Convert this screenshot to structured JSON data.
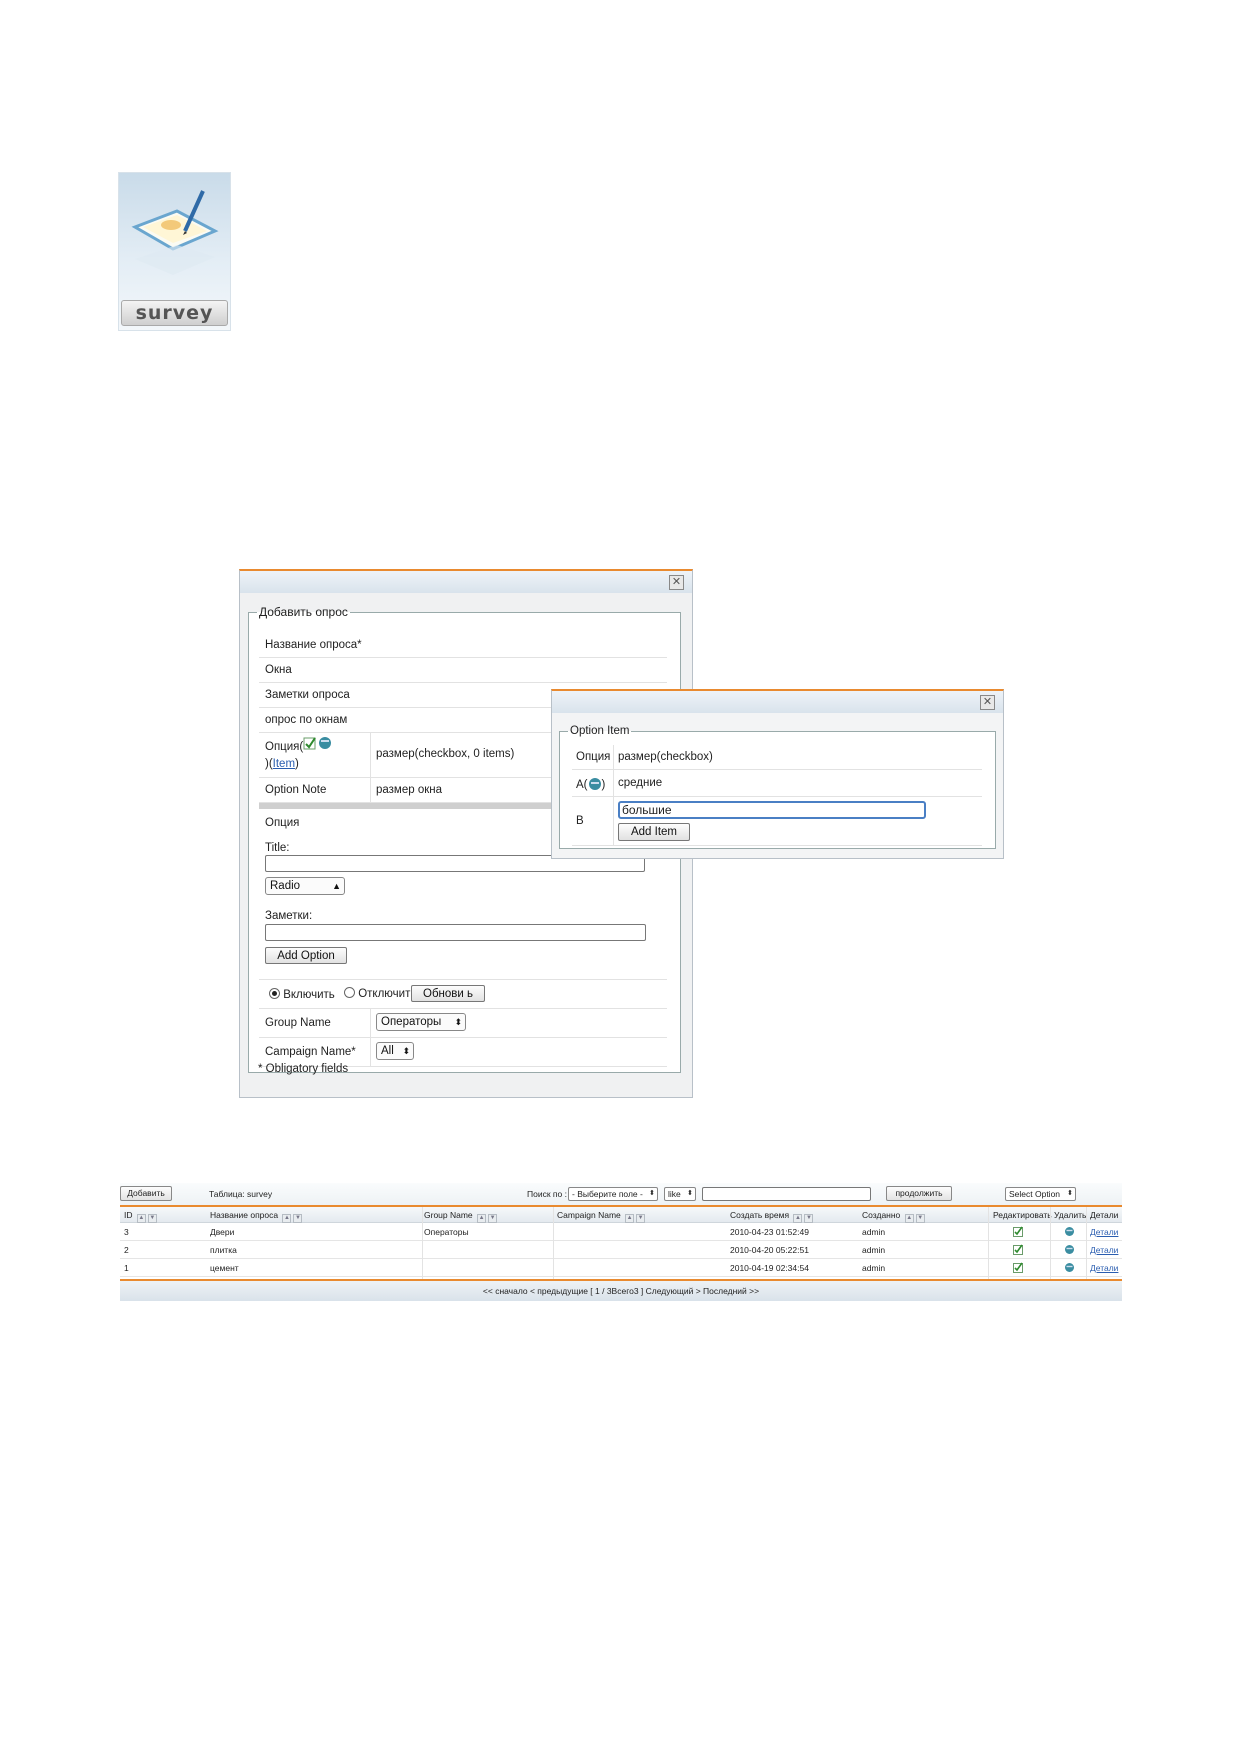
{
  "icon": {
    "label": "survey"
  },
  "add_dialog": {
    "legend": "Добавить опрос",
    "close": "✕",
    "survey_name_label": "Название опроса*",
    "survey_name_value": "Окна",
    "notes_label": "Заметки опроса",
    "notes_value": "опрос по окнам",
    "option_label": "Опция(",
    "option_link": "Item",
    "option_value": "размер(checkbox, 0 items)",
    "option_note_label": "Option Note",
    "option_note_value": "размер окна",
    "option_section": "Опция",
    "title_label": "Title:",
    "type_select": "Radio",
    "notes2_label": "Заметки:",
    "add_option": "Add Option",
    "enable_label": "Включить",
    "disable_label": "Отключить",
    "update_button": "Обнови ь",
    "group_name_label": "Group Name",
    "group_name_value": "Операторы",
    "campaign_label": "Campaign Name*",
    "campaign_value": "All",
    "obligatory": "* Obligatory fields"
  },
  "option_dialog": {
    "legend": "Option Item",
    "close": "✕",
    "row1_label": "Опция",
    "row1_value": "размер(checkbox)",
    "row2_label": "A(",
    "row2_label_end": ")",
    "row2_value": "средние",
    "row3_label": "B",
    "row3_input": "большие",
    "add_item": "Add Item"
  },
  "table": {
    "add_button": "Добавить",
    "table_name": "Таблица: survey",
    "search_label": "Поиск по :",
    "field_select": "- Выберите поле -",
    "op_select": "like",
    "search_value": "",
    "continue_button": "продолжить",
    "select_option": "Select Option",
    "columns": [
      "ID",
      "Название опроса",
      "Group Name",
      "Campaign Name",
      "Создать время",
      "Созданно",
      "Редактировать",
      "Удалить",
      "Детали"
    ],
    "rows": [
      {
        "id": "3",
        "name": "Двери",
        "group": "Операторы",
        "campaign": "",
        "created": "2010-04-23 01:52:49",
        "by": "admin",
        "details": "Детали"
      },
      {
        "id": "2",
        "name": "плитка",
        "group": "",
        "campaign": "",
        "created": "2010-04-20 05:22:51",
        "by": "admin",
        "details": "Детали"
      },
      {
        "id": "1",
        "name": "цемент",
        "group": "",
        "campaign": "",
        "created": "2010-04-19 02:34:54",
        "by": "admin",
        "details": "Детали"
      }
    ],
    "pagination": "<< сначало < предыдущие [ 1 / 3Всего3 ] Следующий > Последний >>"
  },
  "icons": [
    "survey-icon",
    "edit-icon",
    "delete-icon",
    "close-icon",
    "chevron-updown-icon"
  ],
  "colors": {
    "accent": "#e98a2f",
    "link": "#2a5db0"
  }
}
